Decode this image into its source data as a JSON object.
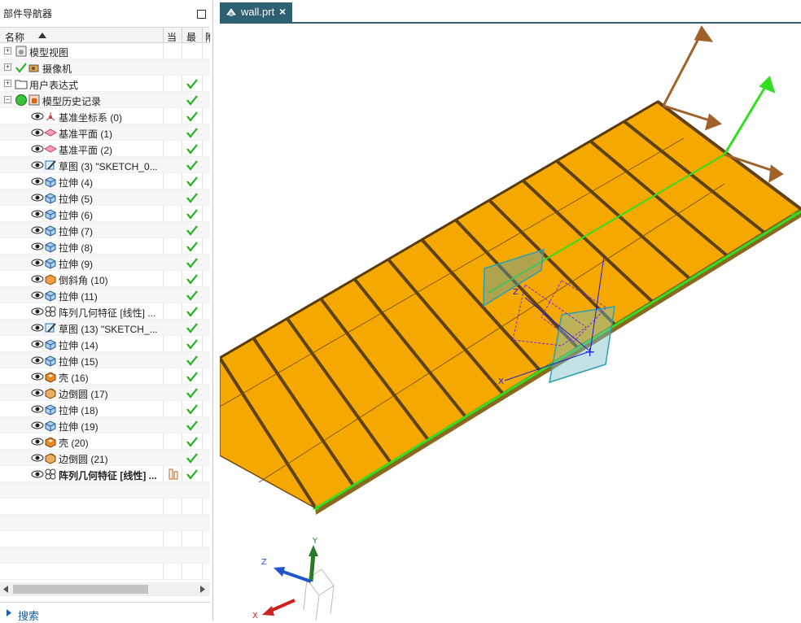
{
  "navigator": {
    "title": "部件导航器",
    "columns": {
      "name": "名称",
      "current": "当",
      "latest": "最",
      "extra": "附"
    },
    "rows": [
      {
        "label": "模型视图",
        "indent": 0,
        "expander": "+",
        "icon": "model-views-icon",
        "check": false
      },
      {
        "label": "摄像机",
        "indent": 0,
        "expander": "+",
        "icon": "camera-icon",
        "check": false,
        "prefix_check": true
      },
      {
        "label": "用户表达式",
        "indent": 0,
        "expander": "+",
        "icon": "folder-icon",
        "check": true
      },
      {
        "label": "模型历史记录",
        "indent": 0,
        "expander": "−",
        "icon": "history-icon",
        "check": true,
        "status_dot": true
      },
      {
        "label": "基准坐标系 (0)",
        "indent": 1,
        "icon": "datum-csys-icon",
        "check": true
      },
      {
        "label": "基准平面 (1)",
        "indent": 1,
        "icon": "datum-plane-icon",
        "check": true
      },
      {
        "label": "基准平面 (2)",
        "indent": 1,
        "icon": "datum-plane-icon",
        "check": true
      },
      {
        "label": "草图 (3) \"SKETCH_0...",
        "indent": 1,
        "icon": "sketch-icon",
        "check": true
      },
      {
        "label": "拉伸 (4)",
        "indent": 1,
        "icon": "extrude-icon",
        "check": true
      },
      {
        "label": "拉伸 (5)",
        "indent": 1,
        "icon": "extrude-icon",
        "check": true
      },
      {
        "label": "拉伸 (6)",
        "indent": 1,
        "icon": "extrude-icon",
        "check": true
      },
      {
        "label": "拉伸 (7)",
        "indent": 1,
        "icon": "extrude-icon",
        "check": true
      },
      {
        "label": "拉伸 (8)",
        "indent": 1,
        "icon": "extrude-icon",
        "check": true
      },
      {
        "label": "拉伸 (9)",
        "indent": 1,
        "icon": "extrude-icon",
        "check": true
      },
      {
        "label": "倒斜角 (10)",
        "indent": 1,
        "icon": "chamfer-icon",
        "check": true
      },
      {
        "label": "拉伸 (11)",
        "indent": 1,
        "icon": "extrude-icon",
        "check": true
      },
      {
        "label": "阵列几何特征 [线性] ...",
        "indent": 1,
        "icon": "pattern-icon",
        "check": true
      },
      {
        "label": "草图 (13) \"SKETCH_...",
        "indent": 1,
        "icon": "sketch-icon",
        "check": true
      },
      {
        "label": "拉伸 (14)",
        "indent": 1,
        "icon": "extrude-icon",
        "check": true
      },
      {
        "label": "拉伸 (15)",
        "indent": 1,
        "icon": "extrude-icon",
        "check": true
      },
      {
        "label": "壳 (16)",
        "indent": 1,
        "icon": "shell-icon",
        "check": true
      },
      {
        "label": "边倒圆 (17)",
        "indent": 1,
        "icon": "edge-blend-icon",
        "check": true
      },
      {
        "label": "拉伸 (18)",
        "indent": 1,
        "icon": "extrude-icon",
        "check": true
      },
      {
        "label": "拉伸 (19)",
        "indent": 1,
        "icon": "extrude-icon",
        "check": true
      },
      {
        "label": "壳 (20)",
        "indent": 1,
        "icon": "shell-icon",
        "check": true
      },
      {
        "label": "边倒圆 (21)",
        "indent": 1,
        "icon": "edge-blend-icon",
        "check": true
      },
      {
        "label": "阵列几何特征 [线性] ...",
        "indent": 1,
        "icon": "pattern-icon",
        "check": true,
        "bold": true,
        "current_marker": true
      }
    ],
    "search_label": "搜索"
  },
  "tab": {
    "label": "wall.prt",
    "close": "×"
  },
  "viewport": {
    "axis_labels": {
      "x": "X",
      "y": "Y",
      "z": "Z"
    },
    "colors": {
      "panel": "#f5a800",
      "panel_edge": "#6b4a10",
      "highlight": "#33dd22",
      "datum": "#2aa0b0",
      "csys": "#1a1adf"
    }
  }
}
